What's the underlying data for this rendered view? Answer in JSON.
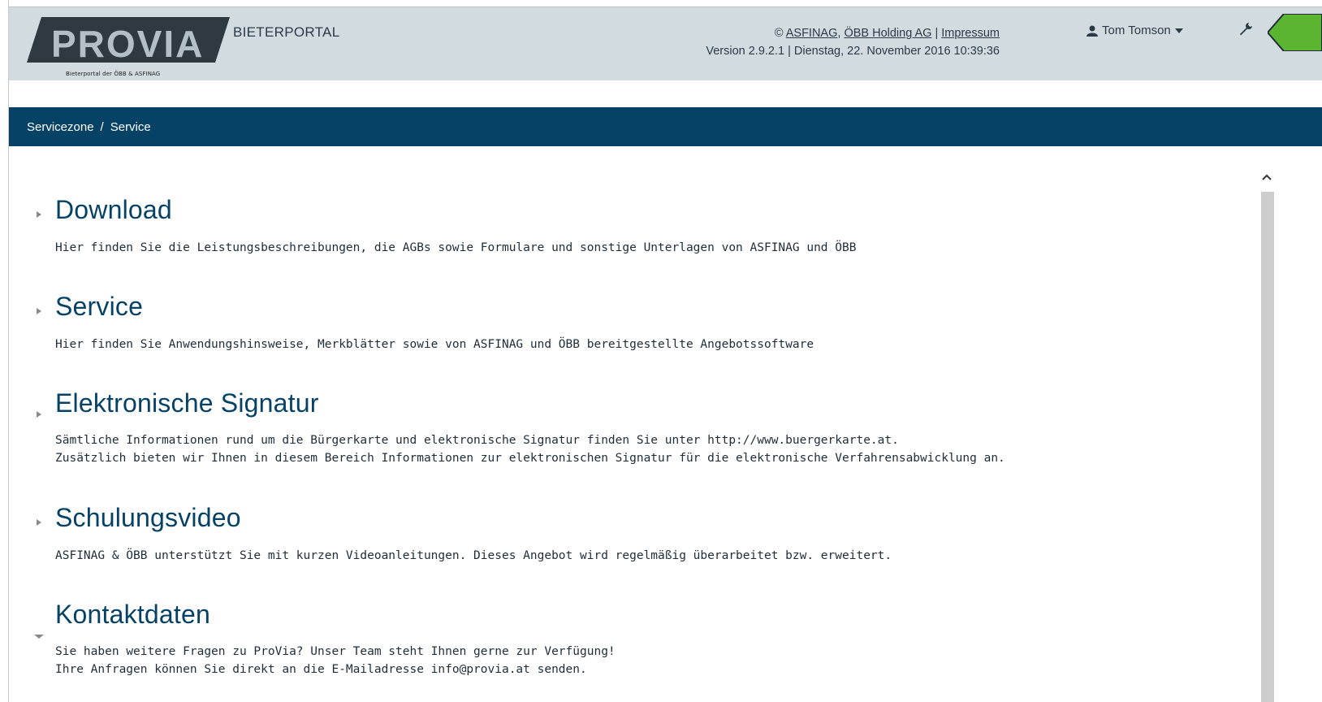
{
  "header": {
    "logo_text": "PROVIA",
    "logo_subtitle": "Bieterportal der ÖBB & ASFINAG",
    "portal_title": "BIETERPORTAL",
    "copyright_symbol": "©",
    "links": [
      "ASFINAG",
      "ÖBB Holding AG",
      "Impressum"
    ],
    "version_line": "Version 2.9.2.1 | Dienstag, 22. November 2016 10:39:36",
    "user_name": "Tom Tomson",
    "user_icon": "user-icon",
    "tools_icon": "wrench-icon"
  },
  "breadcrumb": {
    "items": [
      "Servicezone",
      "Service"
    ],
    "separator": "/"
  },
  "sections": [
    {
      "title": "Download",
      "state": "collapsed",
      "lines": [
        "Hier finden Sie die Leistungsbeschreibungen, die AGBs sowie Formulare und sonstige Unterlagen von ASFINAG und ÖBB"
      ]
    },
    {
      "title": "Service",
      "state": "collapsed",
      "lines": [
        "Hier finden Sie Anwendungshinsweise, Merkblätter sowie von ASFINAG und ÖBB bereitgestellte Angebotssoftware"
      ]
    },
    {
      "title": "Elektronische Signatur",
      "state": "collapsed",
      "lines": [
        "Sämtliche Informationen rund um die Bürgerkarte und elektronische Signatur finden Sie unter http://www.buergerkarte.at.",
        "Zusätzlich bieten wir Ihnen in diesem Bereich Informationen zur elektronischen Signatur für die elektronische Verfahrensabwicklung an."
      ]
    },
    {
      "title": "Schulungsvideo",
      "state": "collapsed",
      "lines": [
        "ASFINAG & ÖBB unterstützt Sie mit kurzen Videoanleitungen. Dieses Angebot wird regelmäßig überarbeitet bzw. erweitert."
      ]
    },
    {
      "title": "Kontaktdaten",
      "state": "expanded",
      "lines": [
        "Sie haben weitere Fragen zu ProVia? Unser Team steht Ihnen gerne zur Verfügung!",
        "Ihre Anfragen können Sie direkt an die E-Mailadresse info@provia.at senden."
      ]
    }
  ],
  "colors": {
    "header_bg": "#d2dbe0",
    "nav_bg": "#064266",
    "heading": "#064266",
    "accent_green": "#5cb531"
  }
}
